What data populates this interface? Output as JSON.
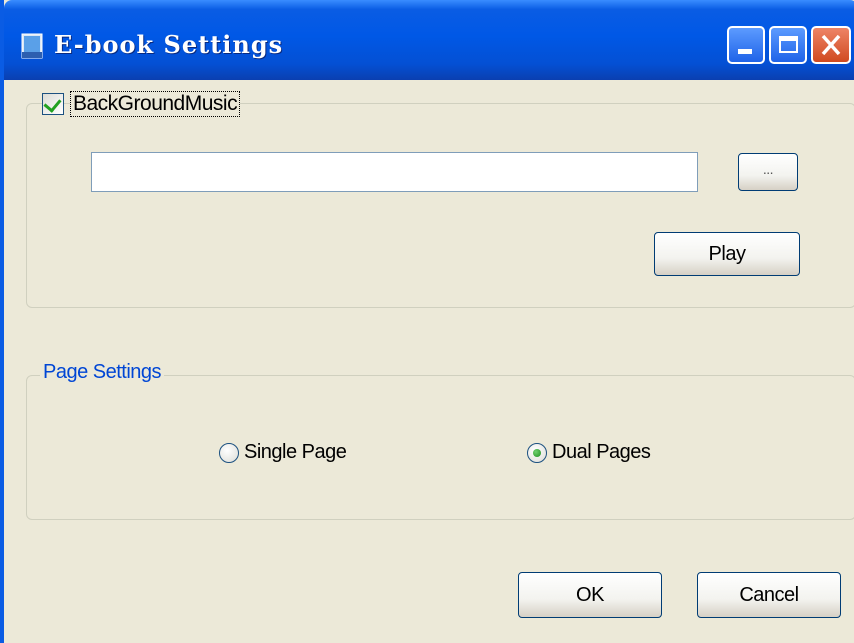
{
  "window": {
    "title": "E-book Settings",
    "icons": {
      "app": "ebook-app-icon",
      "minimize": "minimize-icon",
      "maximize": "maximize-icon",
      "close": "close-icon"
    },
    "colors": {
      "titlebar": "#0058e6",
      "face": "#ece9d8",
      "close_button": "#d04a20"
    }
  },
  "music": {
    "checkbox_label": "BackGroundMusic",
    "checked": true,
    "path_value": "",
    "browse_label": "...",
    "play_label": "Play"
  },
  "page_settings": {
    "legend": "Page Settings",
    "options": [
      {
        "label": "Single Page",
        "selected": false
      },
      {
        "label": "Dual Pages",
        "selected": true
      }
    ]
  },
  "footer": {
    "ok_label": "OK",
    "cancel_label": "Cancel"
  }
}
